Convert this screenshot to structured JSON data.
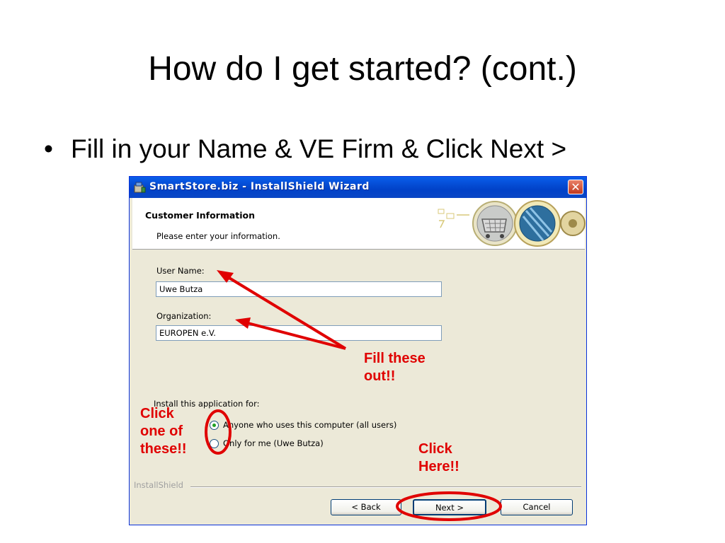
{
  "slide": {
    "title": "How do I get started? (cont.)",
    "bullet_marker": "•",
    "bullet": "Fill in your Name & VE Firm & Click Next >"
  },
  "dialog": {
    "title": "SmartStore.biz - InstallShield Wizard",
    "close_glyph": "✕",
    "header_title": "Customer Information",
    "header_subtitle": "Please enter your information.",
    "user_name_label": "User Name:",
    "user_name_value": "Uwe Butza",
    "organization_label": "Organization:",
    "organization_value": "EUROPEN e.V.",
    "install_for_label": "Install this application for:",
    "radio_all_users": "Anyone who uses this computer (all users)",
    "radio_only_me": "Only for me (Uwe Butza)",
    "radio_selected": "all_users",
    "installshield_label": "InstallShield",
    "back_button": "< Back",
    "next_button": "Next >",
    "cancel_button": "Cancel"
  },
  "annotations": {
    "fill_these": "Fill these\nout!!",
    "click_one": "Click\none of\nthese!!",
    "click_here": "Click\nHere!!"
  },
  "colors": {
    "annotation_red": "#E00000",
    "titlebar_blue": "#0A5EEA",
    "dialog_face": "#ECE9D8",
    "radio_dot_green": "#21A121"
  }
}
